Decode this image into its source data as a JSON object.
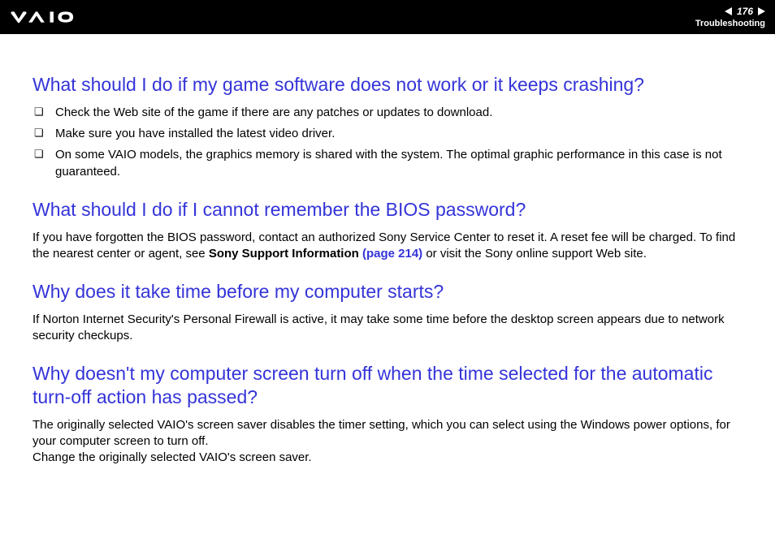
{
  "header": {
    "page_number": "176",
    "section": "Troubleshooting"
  },
  "sections": [
    {
      "heading": "What should I do if my game software does not work or it keeps crashing?",
      "bullets": [
        "Check the Web site of the game if there are any patches or updates to download.",
        "Make sure you have installed the latest video driver.",
        "On some VAIO models, the graphics memory is shared with the system. The optimal graphic performance in this case is not guaranteed."
      ]
    },
    {
      "heading": "What should I do if I cannot remember the BIOS password?",
      "para_pre": "If you have forgotten the BIOS password, contact an authorized Sony Service Center to reset it. A reset fee will be charged. To find the nearest center or agent, see ",
      "para_bold": "Sony Support Information ",
      "para_link": "(page 214)",
      "para_post": " or visit the Sony online support Web site."
    },
    {
      "heading": "Why does it take time before my computer starts?",
      "para": "If Norton Internet Security's Personal Firewall is active, it may take some time before the desktop screen appears due to network security checkups."
    },
    {
      "heading": "Why doesn't my computer screen turn off when the time selected for the automatic turn-off action has passed?",
      "para_a": "The originally selected VAIO's screen saver disables the timer setting, which you can select using the Windows power options, for your computer screen to turn off.",
      "para_b": "Change the originally selected VAIO's screen saver."
    }
  ]
}
